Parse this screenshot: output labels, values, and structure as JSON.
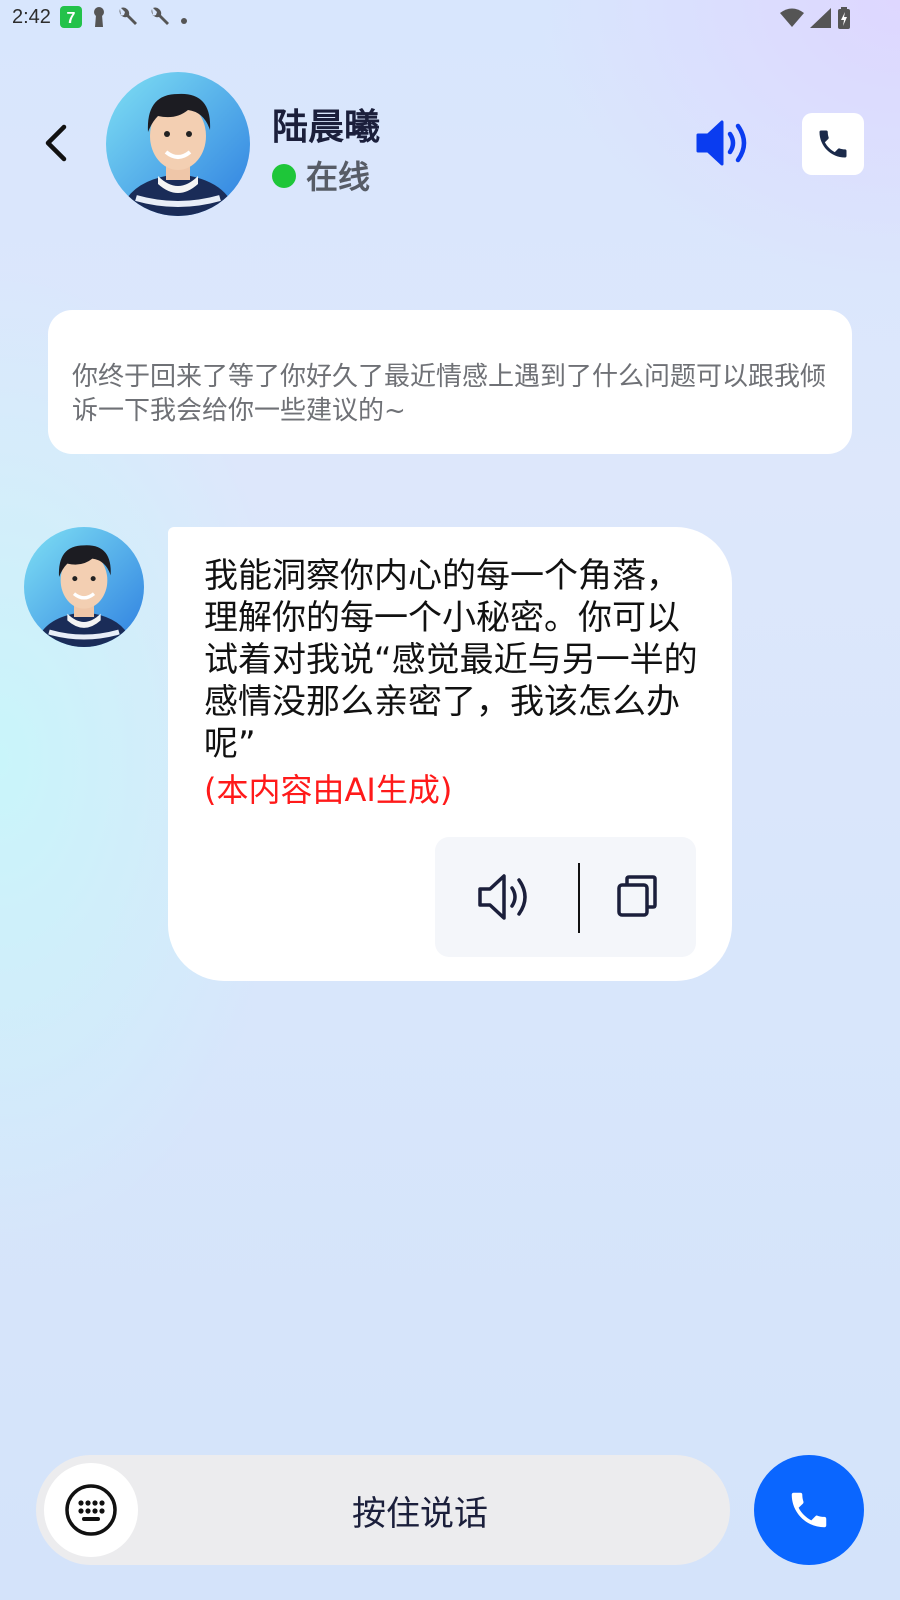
{
  "status_bar": {
    "time": "2:42",
    "left_icons": [
      "app-7-icon",
      "keyhole-icon",
      "wrench-icon",
      "wrench-icon",
      "dot-icon"
    ],
    "right_icons": [
      "wifi-icon",
      "cellular-signal-icon",
      "battery-charging-icon"
    ]
  },
  "header": {
    "back_icon": "chevron-left-icon",
    "contact_name": "陆晨曦",
    "status": "在线",
    "status_color": "#1ec639",
    "speaker_icon": "speaker-icon",
    "speaker_color": "#0a3cf0",
    "call_icon": "phone-icon"
  },
  "greeting": {
    "text": "你终于回来了等了你好久了最近情感上遇到了什么问题可以跟我倾诉一下我会给你一些建议的~"
  },
  "message": {
    "text": "我能洞察你内心的每一个角落，理解你的每一个小秘密。你可以试着对我说“感觉最近与另一半的感情没那么亲密了，我该怎么办呢”",
    "ai_note": "(本内容由AI生成)",
    "ai_note_color": "#ff1a1a",
    "actions": [
      "speaker-outline-icon",
      "copy-icon"
    ]
  },
  "bottom_bar": {
    "keyboard_icon": "keyboard-icon",
    "hold_to_talk_label": "按住说话",
    "call_button_icon": "phone-icon",
    "call_button_color": "#0a66ff"
  }
}
